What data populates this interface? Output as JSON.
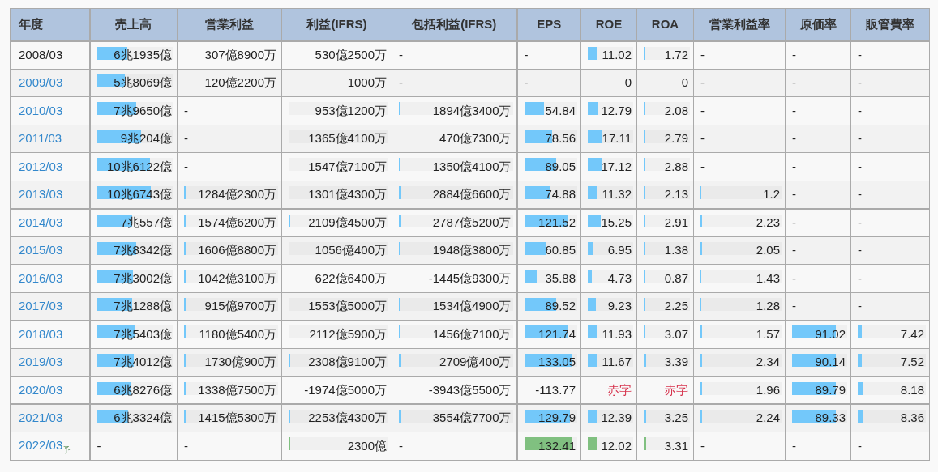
{
  "columns": [
    "年度",
    "売上高",
    "営業利益",
    "利益(IFRS)",
    "包括利益(IFRS)",
    "EPS",
    "ROE",
    "ROA",
    "営業利益率",
    "原価率",
    "販管費率"
  ],
  "rows": [
    {
      "year": {
        "text": "2008/03",
        "link": false
      },
      "forecast": false,
      "divider_above": false,
      "cells": [
        {
          "kind": "number",
          "text": "6兆1935億",
          "level": 0.4
        },
        {
          "kind": "number",
          "text": "307億8900万"
        },
        {
          "kind": "number",
          "text": "530億2500万"
        },
        {
          "kind": "dash",
          "text": "-"
        },
        {
          "kind": "dash",
          "text": "-"
        },
        {
          "kind": "number",
          "text": "11.02",
          "level": 0.2
        },
        {
          "kind": "number",
          "text": "1.72",
          "level": 0.02
        },
        {
          "kind": "dash",
          "text": "-"
        },
        {
          "kind": "dash",
          "text": "-"
        },
        {
          "kind": "dash",
          "text": "-"
        }
      ]
    },
    {
      "year": {
        "text": "2009/03",
        "link": true
      },
      "forecast": false,
      "divider_above": false,
      "cells": [
        {
          "kind": "number",
          "text": "5兆8069億",
          "level": 0.37
        },
        {
          "kind": "number",
          "text": "120億2200万"
        },
        {
          "kind": "number",
          "text": "1000万"
        },
        {
          "kind": "dash",
          "text": "-"
        },
        {
          "kind": "dash",
          "text": "-"
        },
        {
          "kind": "number",
          "text": "0"
        },
        {
          "kind": "number",
          "text": "0"
        },
        {
          "kind": "dash",
          "text": "-"
        },
        {
          "kind": "dash",
          "text": "-"
        },
        {
          "kind": "dash",
          "text": "-"
        }
      ]
    },
    {
      "year": {
        "text": "2010/03",
        "link": true
      },
      "forecast": false,
      "divider_above": false,
      "cells": [
        {
          "kind": "number",
          "text": "7兆9650億",
          "level": 0.51
        },
        {
          "kind": "dash",
          "text": "-"
        },
        {
          "kind": "number",
          "text": "953億1200万",
          "level": 0.01
        },
        {
          "kind": "number",
          "text": "1894億3400万",
          "level": 0.01
        },
        {
          "kind": "number",
          "text": "54.84",
          "level": 0.37
        },
        {
          "kind": "number",
          "text": "12.79",
          "level": 0.23
        },
        {
          "kind": "number",
          "text": "2.08",
          "level": 0.03
        },
        {
          "kind": "dash",
          "text": "-"
        },
        {
          "kind": "dash",
          "text": "-"
        },
        {
          "kind": "dash",
          "text": "-"
        }
      ]
    },
    {
      "year": {
        "text": "2011/03",
        "link": true
      },
      "forecast": false,
      "divider_above": false,
      "cells": [
        {
          "kind": "number",
          "text": "9兆204億",
          "level": 0.58
        },
        {
          "kind": "dash",
          "text": "-"
        },
        {
          "kind": "number",
          "text": "1365億4100万",
          "level": 0.01
        },
        {
          "kind": "number",
          "text": "470億7300万"
        },
        {
          "kind": "number",
          "text": "78.56",
          "level": 0.52
        },
        {
          "kind": "number",
          "text": "17.11",
          "level": 0.32
        },
        {
          "kind": "number",
          "text": "2.79",
          "level": 0.04
        },
        {
          "kind": "dash",
          "text": "-"
        },
        {
          "kind": "dash",
          "text": "-"
        },
        {
          "kind": "dash",
          "text": "-"
        }
      ]
    },
    {
      "year": {
        "text": "2012/03",
        "link": true
      },
      "forecast": false,
      "divider_above": false,
      "cells": [
        {
          "kind": "number",
          "text": "10兆6122億",
          "level": 0.69
        },
        {
          "kind": "dash",
          "text": "-"
        },
        {
          "kind": "number",
          "text": "1547億7100万",
          "level": 0.01
        },
        {
          "kind": "number",
          "text": "1350億4100万",
          "level": 0.01
        },
        {
          "kind": "number",
          "text": "89.05",
          "level": 0.6
        },
        {
          "kind": "number",
          "text": "17.12",
          "level": 0.32
        },
        {
          "kind": "number",
          "text": "2.88",
          "level": 0.04
        },
        {
          "kind": "dash",
          "text": "-"
        },
        {
          "kind": "dash",
          "text": "-"
        },
        {
          "kind": "dash",
          "text": "-"
        }
      ]
    },
    {
      "year": {
        "text": "2013/03",
        "link": true
      },
      "forecast": false,
      "divider_above": false,
      "cells": [
        {
          "kind": "number",
          "text": "10兆6743億",
          "level": 0.7
        },
        {
          "kind": "number",
          "text": "1284億2300万",
          "level": 0.02
        },
        {
          "kind": "number",
          "text": "1301億4300万",
          "level": 0.01
        },
        {
          "kind": "number",
          "text": "2884億6600万",
          "level": 0.02
        },
        {
          "kind": "number",
          "text": "74.88",
          "level": 0.5
        },
        {
          "kind": "number",
          "text": "11.32",
          "level": 0.2
        },
        {
          "kind": "number",
          "text": "2.13",
          "level": 0.03
        },
        {
          "kind": "number",
          "text": "1.2",
          "level": 0.01
        },
        {
          "kind": "dash",
          "text": "-"
        },
        {
          "kind": "dash",
          "text": "-"
        }
      ]
    },
    {
      "year": {
        "text": "2014/03",
        "link": true
      },
      "forecast": false,
      "divider_above": true,
      "cells": [
        {
          "kind": "number",
          "text": "7兆557億",
          "level": 0.46
        },
        {
          "kind": "number",
          "text": "1574億6200万",
          "level": 0.02
        },
        {
          "kind": "number",
          "text": "2109億4500万",
          "level": 0.02
        },
        {
          "kind": "number",
          "text": "2787億5200万",
          "level": 0.02
        },
        {
          "kind": "number",
          "text": "121.52",
          "level": 0.81
        },
        {
          "kind": "number",
          "text": "15.25",
          "level": 0.28
        },
        {
          "kind": "number",
          "text": "2.91",
          "level": 0.04
        },
        {
          "kind": "number",
          "text": "2.23",
          "level": 0.02
        },
        {
          "kind": "dash",
          "text": "-"
        },
        {
          "kind": "dash",
          "text": "-"
        }
      ]
    },
    {
      "year": {
        "text": "2015/03",
        "link": true
      },
      "forecast": false,
      "divider_above": true,
      "cells": [
        {
          "kind": "number",
          "text": "7兆8342億",
          "level": 0.51
        },
        {
          "kind": "number",
          "text": "1606億8800万",
          "level": 0.02
        },
        {
          "kind": "number",
          "text": "1056億400万",
          "level": 0.01
        },
        {
          "kind": "number",
          "text": "1948億3800万",
          "level": 0.01
        },
        {
          "kind": "number",
          "text": "60.85",
          "level": 0.41
        },
        {
          "kind": "number",
          "text": "6.95",
          "level": 0.13
        },
        {
          "kind": "number",
          "text": "1.38",
          "level": 0.02
        },
        {
          "kind": "number",
          "text": "2.05",
          "level": 0.02
        },
        {
          "kind": "dash",
          "text": "-"
        },
        {
          "kind": "dash",
          "text": "-"
        }
      ]
    },
    {
      "year": {
        "text": "2016/03",
        "link": true
      },
      "forecast": false,
      "divider_above": false,
      "cells": [
        {
          "kind": "number",
          "text": "7兆3002億",
          "level": 0.47
        },
        {
          "kind": "number",
          "text": "1042億3100万",
          "level": 0.02
        },
        {
          "kind": "number",
          "text": "622億6400万"
        },
        {
          "kind": "number",
          "text": "-1445億9300万"
        },
        {
          "kind": "number",
          "text": "35.88",
          "level": 0.23
        },
        {
          "kind": "number",
          "text": "4.73",
          "level": 0.09
        },
        {
          "kind": "number",
          "text": "0.87",
          "level": 0.01
        },
        {
          "kind": "number",
          "text": "1.43",
          "level": 0.01
        },
        {
          "kind": "dash",
          "text": "-"
        },
        {
          "kind": "dash",
          "text": "-"
        }
      ]
    },
    {
      "year": {
        "text": "2017/03",
        "link": true
      },
      "forecast": false,
      "divider_above": false,
      "cells": [
        {
          "kind": "number",
          "text": "7兆1288億",
          "level": 0.46
        },
        {
          "kind": "number",
          "text": "915億9700万",
          "level": 0.02
        },
        {
          "kind": "number",
          "text": "1553億5000万",
          "level": 0.01
        },
        {
          "kind": "number",
          "text": "1534億4900万",
          "level": 0.01
        },
        {
          "kind": "number",
          "text": "89.52",
          "level": 0.6
        },
        {
          "kind": "number",
          "text": "9.23",
          "level": 0.17
        },
        {
          "kind": "number",
          "text": "2.25",
          "level": 0.03
        },
        {
          "kind": "number",
          "text": "1.28",
          "level": 0.01
        },
        {
          "kind": "dash",
          "text": "-"
        },
        {
          "kind": "dash",
          "text": "-"
        }
      ]
    },
    {
      "year": {
        "text": "2018/03",
        "link": true
      },
      "forecast": false,
      "divider_above": false,
      "cells": [
        {
          "kind": "number",
          "text": "7兆5403億",
          "level": 0.49
        },
        {
          "kind": "number",
          "text": "1180億5400万",
          "level": 0.02
        },
        {
          "kind": "number",
          "text": "2112億5900万",
          "level": 0.01
        },
        {
          "kind": "number",
          "text": "1456億7100万",
          "level": 0.01
        },
        {
          "kind": "number",
          "text": "121.74",
          "level": 0.81
        },
        {
          "kind": "number",
          "text": "11.93",
          "level": 0.22
        },
        {
          "kind": "number",
          "text": "3.07",
          "level": 0.04
        },
        {
          "kind": "number",
          "text": "1.57",
          "level": 0.02
        },
        {
          "kind": "number",
          "text": "91.02",
          "level": 0.8
        },
        {
          "kind": "number",
          "text": "7.42",
          "level": 0.06
        }
      ]
    },
    {
      "year": {
        "text": "2019/03",
        "link": true
      },
      "forecast": false,
      "divider_above": false,
      "cells": [
        {
          "kind": "number",
          "text": "7兆4012億",
          "level": 0.48
        },
        {
          "kind": "number",
          "text": "1730億900万",
          "level": 0.02
        },
        {
          "kind": "number",
          "text": "2308億9100万",
          "level": 0.02
        },
        {
          "kind": "number",
          "text": "2709億400万",
          "level": 0.02
        },
        {
          "kind": "number",
          "text": "133.05",
          "level": 0.89
        },
        {
          "kind": "number",
          "text": "11.67",
          "level": 0.21
        },
        {
          "kind": "number",
          "text": "3.39",
          "level": 0.05
        },
        {
          "kind": "number",
          "text": "2.34",
          "level": 0.02
        },
        {
          "kind": "number",
          "text": "90.14",
          "level": 0.8
        },
        {
          "kind": "number",
          "text": "7.52",
          "level": 0.06
        }
      ]
    },
    {
      "year": {
        "text": "2020/03",
        "link": true
      },
      "forecast": false,
      "divider_above": true,
      "cells": [
        {
          "kind": "number",
          "text": "6兆8276億",
          "level": 0.44
        },
        {
          "kind": "number",
          "text": "1338億7500万",
          "level": 0.02
        },
        {
          "kind": "number",
          "text": "-1974億5000万"
        },
        {
          "kind": "number",
          "text": "-3943億5500万"
        },
        {
          "kind": "number",
          "text": "-113.77"
        },
        {
          "kind": "deficit",
          "text": "赤字"
        },
        {
          "kind": "deficit",
          "text": "赤字"
        },
        {
          "kind": "number",
          "text": "1.96",
          "level": 0.02
        },
        {
          "kind": "number",
          "text": "89.79",
          "level": 0.8
        },
        {
          "kind": "number",
          "text": "8.18",
          "level": 0.07
        }
      ]
    },
    {
      "year": {
        "text": "2021/03",
        "link": true
      },
      "forecast": false,
      "divider_above": true,
      "cells": [
        {
          "kind": "number",
          "text": "6兆3324億",
          "level": 0.41
        },
        {
          "kind": "number",
          "text": "1415億5300万",
          "level": 0.02
        },
        {
          "kind": "number",
          "text": "2253億4300万",
          "level": 0.02
        },
        {
          "kind": "number",
          "text": "3554億7700万",
          "level": 0.02
        },
        {
          "kind": "number",
          "text": "129.79",
          "level": 0.87
        },
        {
          "kind": "number",
          "text": "12.39",
          "level": 0.22
        },
        {
          "kind": "number",
          "text": "3.25",
          "level": 0.05
        },
        {
          "kind": "number",
          "text": "2.24",
          "level": 0.02
        },
        {
          "kind": "number",
          "text": "89.33",
          "level": 0.8
        },
        {
          "kind": "number",
          "text": "8.36",
          "level": 0.07
        }
      ]
    },
    {
      "year": {
        "text": "2022/03",
        "link": true,
        "mark": "予"
      },
      "forecast": true,
      "divider_above": false,
      "cells": [
        {
          "kind": "dash",
          "text": "-"
        },
        {
          "kind": "dash",
          "text": "-"
        },
        {
          "kind": "number",
          "text": "2300億",
          "level": 0.02
        },
        {
          "kind": "dash",
          "text": "-"
        },
        {
          "kind": "number",
          "text": "132.41",
          "level": 0.89
        },
        {
          "kind": "number",
          "text": "12.02",
          "level": 0.21
        },
        {
          "kind": "number",
          "text": "3.31",
          "level": 0.05
        },
        {
          "kind": "dash",
          "text": "-"
        },
        {
          "kind": "dash",
          "text": "-"
        },
        {
          "kind": "dash",
          "text": "-"
        }
      ]
    }
  ]
}
